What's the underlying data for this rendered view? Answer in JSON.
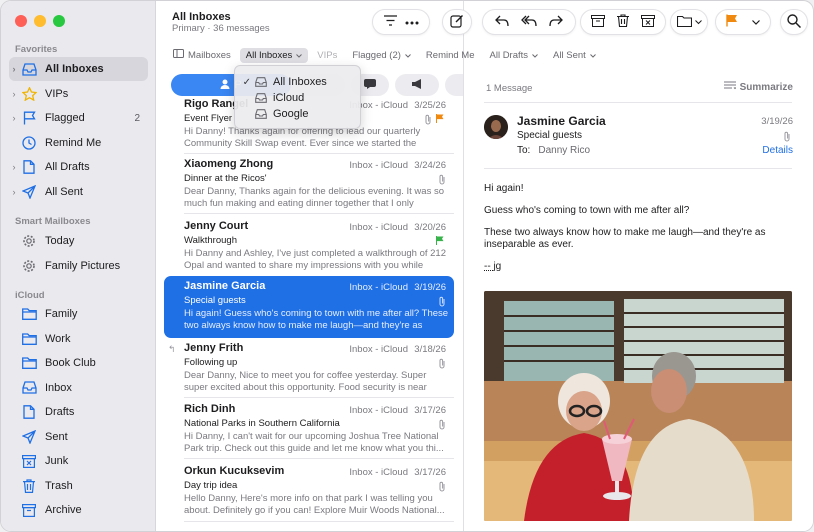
{
  "colors": {
    "accent": "#1f6fe5",
    "flag_orange": "#f0890f",
    "flag_green": "#38b24a"
  },
  "sidebar": {
    "favorites_title": "Favorites",
    "favorites": [
      {
        "label": "All Inboxes",
        "icon": "tray-icon",
        "selected": true,
        "chevron": true
      },
      {
        "label": "VIPs",
        "icon": "star-icon",
        "chevron": true
      },
      {
        "label": "Flagged",
        "icon": "flag-icon",
        "count": "2",
        "chevron": true
      },
      {
        "label": "Remind Me",
        "icon": "clock-icon"
      },
      {
        "label": "All Drafts",
        "icon": "document-icon",
        "chevron": true
      },
      {
        "label": "All Sent",
        "icon": "paperplane-icon",
        "chevron": true
      }
    ],
    "smart_title": "Smart Mailboxes",
    "smart": [
      {
        "label": "Today",
        "icon": "gear-icon"
      },
      {
        "label": "Family Pictures",
        "icon": "gear-icon"
      }
    ],
    "icloud_title": "iCloud",
    "icloud": [
      {
        "label": "Family",
        "icon": "folder-icon"
      },
      {
        "label": "Work",
        "icon": "folder-icon"
      },
      {
        "label": "Book Club",
        "icon": "folder-icon"
      },
      {
        "label": "Inbox",
        "icon": "tray-icon"
      },
      {
        "label": "Drafts",
        "icon": "document-icon"
      },
      {
        "label": "Sent",
        "icon": "paperplane-icon"
      },
      {
        "label": "Junk",
        "icon": "junk-icon"
      },
      {
        "label": "Trash",
        "icon": "trash-icon"
      },
      {
        "label": "Archive",
        "icon": "archive-icon"
      }
    ]
  },
  "header": {
    "title": "All Inboxes",
    "subtitle": "Primary · 36 messages"
  },
  "favorites_bar": [
    {
      "label": "Mailboxes",
      "icon": "sidebar-icon"
    },
    {
      "label": "All Inboxes",
      "chevron": true,
      "selected": true
    },
    {
      "label": "VIPs",
      "dim": true
    },
    {
      "label": "Flagged (2)",
      "chevron": true
    },
    {
      "label": "Remind Me"
    },
    {
      "label": "All Drafts",
      "chevron": true
    },
    {
      "label": "All Sent",
      "chevron": true
    }
  ],
  "category_tab_selected": "P",
  "dropdown": {
    "items": [
      {
        "label": "All Inboxes",
        "checked": true
      },
      {
        "label": "iCloud",
        "checked": false
      },
      {
        "label": "Google",
        "checked": false
      }
    ]
  },
  "messages": [
    {
      "from": "Rigo Rangel",
      "mailbox": "Inbox - iCloud",
      "date": "3/25/26",
      "subject": "Event Flyer",
      "preview": "Hi Danny! Thanks again for offering to lead our quarterly Community Skill Swap event. Ever since we started the series,...",
      "attachment": true,
      "flag": "orange"
    },
    {
      "from": "Xiaomeng Zhong",
      "mailbox": "Inbox - iCloud",
      "date": "3/24/26",
      "subject": "Dinner at the Ricos'",
      "preview": "Dear Danny, Thanks again for the delicious evening. It was so much fun making and eating dinner together that I only remem...",
      "attachment": true
    },
    {
      "from": "Jenny Court",
      "mailbox": "Inbox - iCloud",
      "date": "3/20/26",
      "subject": "Walkthrough",
      "preview": "Hi Danny and Ashley, I've just completed a walkthrough of 212 Opal and wanted to share my impressions with you while they'r...",
      "flag": "green"
    },
    {
      "from": "Jasmine Garcia",
      "mailbox": "Inbox - iCloud",
      "date": "3/19/26",
      "subject": "Special guests",
      "preview": "Hi again! Guess who's coming to town with me after all? These two always know how to make me laugh—and they're as insepa...",
      "attachment": true,
      "selected": true
    },
    {
      "from": "Jenny Frith",
      "mailbox": "Inbox - iCloud",
      "date": "3/18/26",
      "subject": "Following up",
      "preview": "Dear Danny, Nice to meet you for coffee yesterday. Super super excited about this opportunity. Food security is near and...",
      "attachment": true,
      "replied": true
    },
    {
      "from": "Rich Dinh",
      "mailbox": "Inbox - iCloud",
      "date": "3/17/26",
      "subject": "National Parks in Southern California",
      "preview": "Hi Danny, I can't wait for our upcoming Joshua Tree National Park trip. Check out this guide and let me know what you thi...",
      "attachment": true
    },
    {
      "from": "Orkun Kucuksevim",
      "mailbox": "Inbox - iCloud",
      "date": "3/17/26",
      "subject": "Day trip idea",
      "preview": "Hello Danny, Here's more info on that park I was telling you about. Definitely go if you can! Explore Muir Woods National...",
      "attachment": true
    }
  ],
  "reader": {
    "count": "1 Message",
    "summarize": "Summarize",
    "from": "Jasmine Garcia",
    "date": "3/19/26",
    "subject": "Special guests",
    "to_label": "To:",
    "to_value": "Danny Rico",
    "details": "Details",
    "body": [
      "Hi again!",
      "Guess who's coming to town with me after all?",
      "These two always know how to make me laugh—and they're as inseparable as ever.",
      "-- jg"
    ]
  }
}
